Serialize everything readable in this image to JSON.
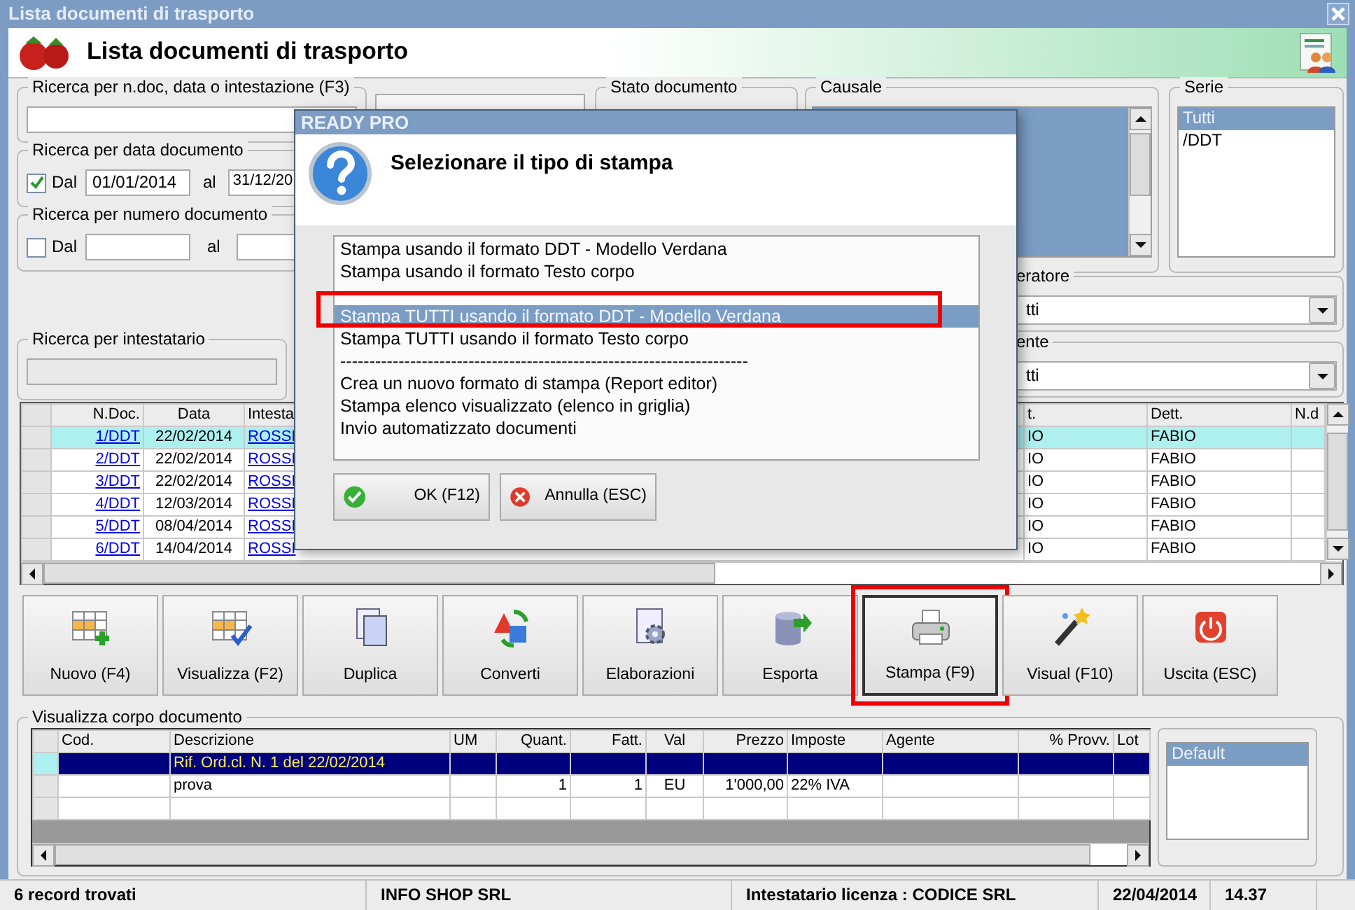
{
  "window": {
    "title": "Lista documenti di trasporto"
  },
  "header": {
    "title": "Lista documenti di trasporto"
  },
  "filters": {
    "search": {
      "label": "Ricerca per n.doc, data o intestazione (F3)"
    },
    "date": {
      "label": "Ricerca per data documento",
      "checkbox": {
        "label": "Dal",
        "checked": true
      },
      "from": "01/01/2014",
      "to_label": "al",
      "to": "31/12/20"
    },
    "number": {
      "label": "Ricerca per numero documento",
      "checkbox": {
        "label": "Dal",
        "checked": false
      },
      "to_label": "al"
    },
    "stato": {
      "label": "Stato documento"
    },
    "causale": {
      "label": "Causale"
    },
    "serie": {
      "label": "Serie",
      "items": [
        {
          "label": "Tutti",
          "selected": true
        },
        {
          "label": "/DDT",
          "selected": false
        }
      ]
    },
    "intestatario": {
      "label": "Ricerca per intestatario"
    },
    "combos": [
      {
        "label": "eratore",
        "value": "tti"
      },
      {
        "label": "ente",
        "value": "tti"
      }
    ]
  },
  "table": {
    "columns": [
      "N.Doc.",
      "Data",
      "Intesta",
      "t.",
      "Dett.",
      "N.d"
    ],
    "rows": [
      {
        "selected": true,
        "number": "1/DDT",
        "date": "22/02/2014",
        "holder": "ROSSI",
        "column_4": "IO",
        "detail": "FABIO"
      },
      {
        "selected": false,
        "number": "2/DDT",
        "date": "22/02/2014",
        "holder": "ROSSI",
        "column_4": "IO",
        "detail": "FABIO"
      },
      {
        "selected": false,
        "number": "3/DDT",
        "date": "22/02/2014",
        "holder": "ROSSI",
        "column_4": "IO",
        "detail": "FABIO"
      },
      {
        "selected": false,
        "number": "4/DDT",
        "date": "12/03/2014",
        "holder": "ROSSI",
        "column_4": "IO",
        "detail": "FABIO"
      },
      {
        "selected": false,
        "number": "5/DDT",
        "date": "08/04/2014",
        "holder": "ROSSI",
        "column_4": "IO",
        "detail": "FABIO"
      },
      {
        "selected": false,
        "number": "6/DDT",
        "date": "14/04/2014",
        "holder": "ROSSI",
        "column_4": "IO",
        "detail": "FABIO"
      }
    ]
  },
  "toolbar": [
    {
      "label": "Nuovo (F4)",
      "highlighted": false
    },
    {
      "label": "Visualizza (F2)",
      "highlighted": false
    },
    {
      "label": "Duplica",
      "highlighted": false
    },
    {
      "label": "Converti",
      "highlighted": false
    },
    {
      "label": "Elaborazioni",
      "highlighted": false
    },
    {
      "label": "Esporta",
      "highlighted": false
    },
    {
      "label": "Stampa (F9)",
      "highlighted": true
    },
    {
      "label": "Visual (F10)",
      "highlighted": false
    },
    {
      "label": "Uscita (ESC)",
      "highlighted": false
    }
  ],
  "body": {
    "label": "Visualizza corpo documento",
    "columns": [
      "Cod.",
      "Descrizione",
      "UM",
      "Quant.",
      "Fatt.",
      "Val",
      "Prezzo",
      "Imposte",
      "Agente",
      "% Provv.",
      "Lot"
    ],
    "rows": [
      {
        "kind": "reference",
        "selected": true,
        "description": "Rif. Ord.cl. N. 1 del 22/02/2014"
      },
      {
        "kind": "item",
        "selected": false,
        "description": "prova",
        "quantity": "1",
        "factor": "1",
        "currency": "EU",
        "price": "1'000,00",
        "tax": "22% IVA"
      },
      {
        "kind": "new",
        "selected": false
      }
    ],
    "layouts": [
      {
        "label": "Default",
        "selected": true
      }
    ]
  },
  "status_bar": [
    "6 record trovati",
    "INFO SHOP SRL",
    "Intestatario licenza : CODICE SRL",
    "22/04/2014",
    "14.37"
  ],
  "dialog": {
    "title": "READY PRO",
    "heading": "Selezionare il tipo di stampa",
    "options": [
      {
        "kind": "option",
        "label": "Stampa usando il formato DDT - Modello Verdana",
        "selected": false,
        "highlighted": false
      },
      {
        "kind": "option",
        "label": "Stampa usando il formato Testo corpo",
        "selected": false,
        "highlighted": false
      },
      {
        "kind": "blank"
      },
      {
        "kind": "option",
        "label": "Stampa TUTTI usando il formato DDT - Modello Verdana",
        "selected": true,
        "highlighted": true
      },
      {
        "kind": "option",
        "label": "Stampa TUTTI usando il formato Testo corpo",
        "selected": false,
        "highlighted": false
      },
      {
        "kind": "separator",
        "label": "----------------------------------------------------------------------"
      },
      {
        "kind": "option",
        "label": "Crea un nuovo formato di stampa (Report editor)",
        "selected": false,
        "highlighted": false
      },
      {
        "kind": "option",
        "label": "Stampa elenco visualizzato (elenco in griglia)",
        "selected": false,
        "highlighted": false
      },
      {
        "kind": "option",
        "label": "Invio automatizzato documenti",
        "selected": false,
        "highlighted": false
      }
    ],
    "buttons": [
      {
        "label": "OK (F12)",
        "kind": "ok"
      },
      {
        "label": "Annulla (ESC)",
        "kind": "cancel"
      }
    ]
  }
}
